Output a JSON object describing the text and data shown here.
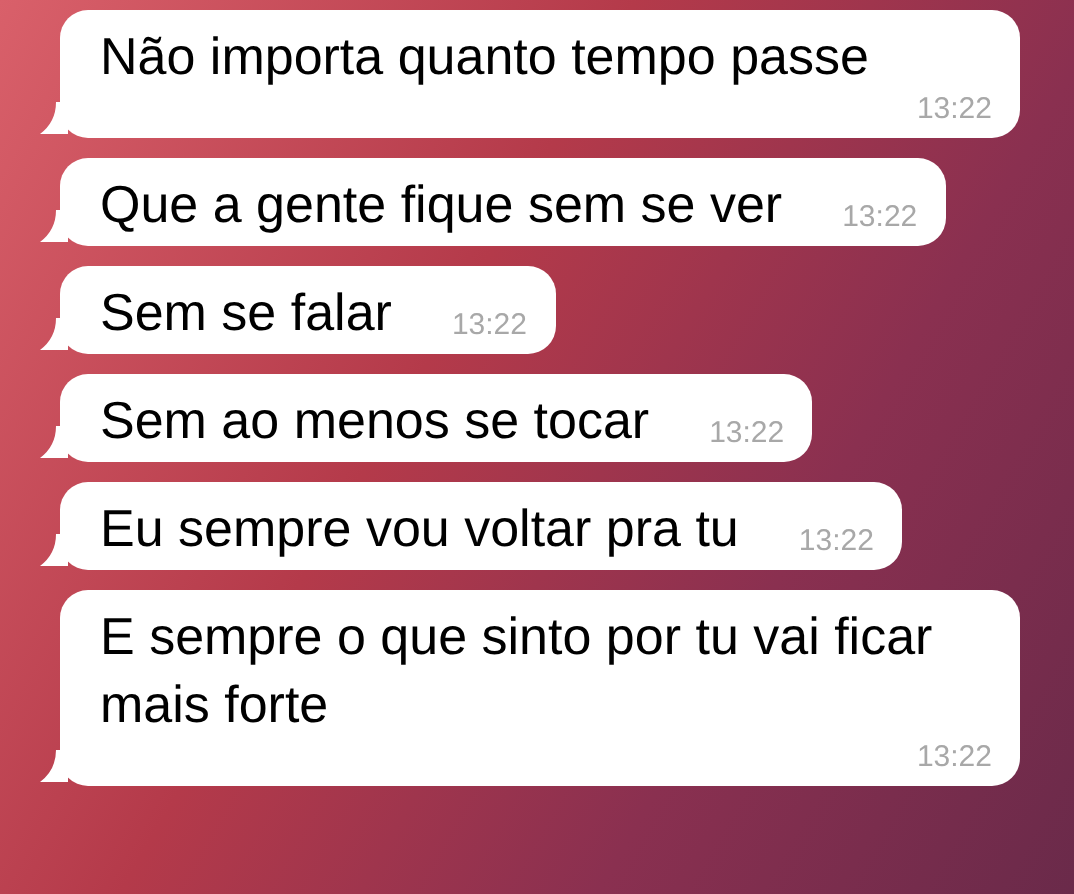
{
  "messages": [
    {
      "text": "Não importa quanto tempo passe",
      "time": "13:22"
    },
    {
      "text": "Que a gente fique sem se ver",
      "time": "13:22"
    },
    {
      "text": "Sem se falar",
      "time": "13:22"
    },
    {
      "text": "Sem ao menos se tocar",
      "time": "13:22"
    },
    {
      "text": "Eu sempre vou voltar pra tu",
      "time": "13:22"
    },
    {
      "text": "E sempre o que sinto por tu vai ficar mais forte",
      "time": "13:22"
    }
  ]
}
